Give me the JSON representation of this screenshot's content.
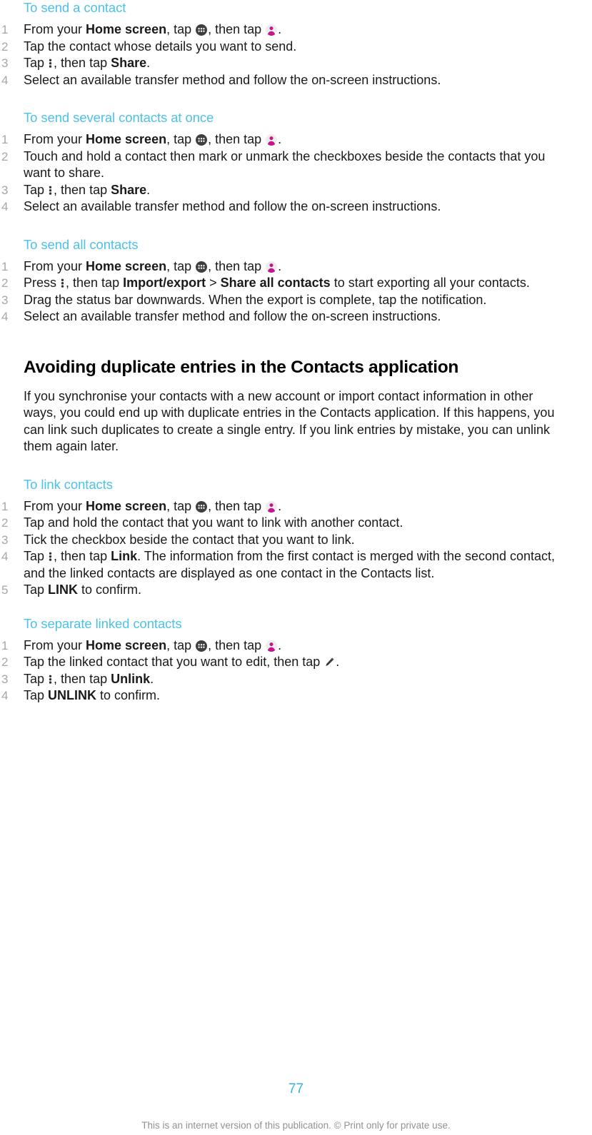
{
  "document": {
    "page_number": "77",
    "footer_note": "This is an internet version of this publication. © Print only for private use.",
    "heading_color": "#4cc2e8",
    "page_number_color": "#31b3e0",
    "body_color": "#1a1a1a",
    "step_number_color": "#a6a6a6",
    "footer_color": "#919191",
    "contacts_icon_color": "#c5148c"
  },
  "icons": {
    "app_drawer": "app-drawer-icon",
    "contacts": "contacts-icon",
    "overflow_menu": "overflow-menu-icon",
    "pencil": "pencil-edit-icon"
  },
  "sections": {
    "send_contact": {
      "heading": "To send a contact",
      "steps": {
        "s1_a": "From your ",
        "s1_b": "Home screen",
        "s1_c": ", tap ",
        "s1_d": ", then tap ",
        "s1_e": ".",
        "s2": "Tap the contact whose details you want to send.",
        "s3_a": "Tap ",
        "s3_b": ", then tap ",
        "s3_c": "Share",
        "s3_d": ".",
        "s4": "Select an available transfer method and follow the on-screen instructions."
      }
    },
    "send_several": {
      "heading": "To send several contacts at once",
      "steps": {
        "s1_a": "From your ",
        "s1_b": "Home screen",
        "s1_c": ", tap ",
        "s1_d": ", then tap ",
        "s1_e": ".",
        "s2": "Touch and hold a contact then mark or unmark the checkboxes beside the contacts that you want to share.",
        "s3_a": "Tap ",
        "s3_b": ", then tap ",
        "s3_c": "Share",
        "s3_d": ".",
        "s4": "Select an available transfer method and follow the on-screen instructions."
      }
    },
    "send_all": {
      "heading": "To send all contacts",
      "steps": {
        "s1_a": "From your ",
        "s1_b": "Home screen",
        "s1_c": ", tap ",
        "s1_d": ", then tap ",
        "s1_e": ".",
        "s2_a": "Press ",
        "s2_b": ", then tap ",
        "s2_c": "Import/export",
        "s2_d": " > ",
        "s2_e": "Share all contacts",
        "s2_f": " to start exporting all your contacts.",
        "s3": "Drag the status bar downwards. When the export is complete, tap the notification.",
        "s4": "Select an available transfer method and follow the on-screen instructions."
      }
    },
    "avoiding_duplicates": {
      "heading": "Avoiding duplicate entries in the Contacts application",
      "paragraph": "If you synchronise your contacts with a new account or import contact information in other ways, you could end up with duplicate entries in the Contacts application. If this happens, you can link such duplicates to create a single entry. If you link entries by mistake, you can unlink them again later."
    },
    "link_contacts": {
      "heading": "To link contacts",
      "steps": {
        "s1_a": "From your ",
        "s1_b": "Home screen",
        "s1_c": ", tap ",
        "s1_d": ", then tap ",
        "s1_e": ".",
        "s2": "Tap and hold the contact that you want to link with another contact.",
        "s3": "Tick the checkbox beside the contact that you want to link.",
        "s4_a": "Tap ",
        "s4_b": ", then tap ",
        "s4_c": "Link",
        "s4_d": ". The information from the first contact is merged with the second contact, and the linked contacts are displayed as one contact in the Contacts list.",
        "s5_a": "Tap ",
        "s5_b": "LINK",
        "s5_c": " to confirm."
      }
    },
    "separate_linked": {
      "heading": "To separate linked contacts",
      "steps": {
        "s1_a": "From your ",
        "s1_b": "Home screen",
        "s1_c": ", tap ",
        "s1_d": ", then tap ",
        "s1_e": ".",
        "s2_a": "Tap the linked contact that you want to edit, then tap ",
        "s2_b": ".",
        "s3_a": "Tap ",
        "s3_b": ", then tap ",
        "s3_c": "Unlink",
        "s3_d": ".",
        "s4_a": "Tap ",
        "s4_b": "UNLINK",
        "s4_c": " to confirm."
      }
    }
  }
}
